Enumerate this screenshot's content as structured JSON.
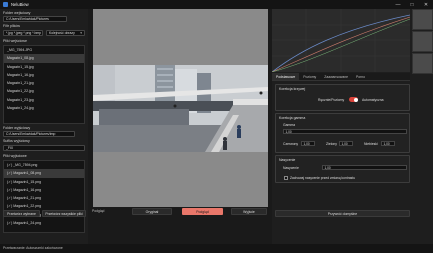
{
  "window": {
    "title": "NeluBiew",
    "controls": [
      "—",
      "□",
      "✕"
    ]
  },
  "left_panel": {
    "input_folder_label": "Folder wejściowy",
    "input_folder_value": "C:/Users/Emkwidak/Pictures",
    "file_filter_label": "Filtr plików",
    "file_filter_value": "*.jpg *.jpeg *.png *.bmp *.tif *.tiff *.webp",
    "sort_value": "Kolejność obrazy",
    "input_files_label": "Pliki wejściowe",
    "input_files": [
      "_MG_7594.JPG",
      "Magazin1_08.jpg",
      "Magazin1_15.jpg",
      "Magazin1_16.jpg",
      "Magazin1_21.jpg",
      "Magazin1_22.jpg",
      "Magazin1_23.jpg",
      "Magazin1_24.jpg"
    ],
    "input_selected_index": 1,
    "output_folder_label": "Folder wyjściowy",
    "output_folder_value": "C:/Users/Emkwidak/Pictures/tmp",
    "suffix_label": "Sufiks wyjściowy",
    "suffix_value": "_FIX",
    "output_files_label": "Pliki wyjściowe",
    "output_files": [
      "(✓) _MG_7594.png",
      "(✓) Magazin1_08.png",
      "(✓) Magazin1_15.png",
      "(✓) Magazin1_16.png",
      "(✓) Magazin1_21.png",
      "(✓) Magazin1_22.png",
      "(✓) Magazin1_23.png",
      "(✓) Magazin1_24.png"
    ],
    "output_selected_index": 1,
    "process_selected_label": "Przetwórz wybrane",
    "process_all_label": "Przetwórz wszystkie pliki"
  },
  "preview": {
    "label": "Podgląd",
    "original_label": "Oryginał",
    "preview_label": "Podgląd",
    "compare_label": "Wyjście"
  },
  "right_panel": {
    "tabs": [
      "Podstawowe",
      "Poziomy",
      "Zaawansowane",
      "Porno"
    ],
    "active_tab_index": 0,
    "curve_group_title": "Korekcja krzywej",
    "curve_mode_manual": "Ręcznie/Poziomy",
    "curve_mode_auto": "Automatyczna",
    "gamma_group_title": "Korekcja gamma",
    "gamma_label": "Gamma",
    "gamma_value": "1,00",
    "red_label": "Czerwony",
    "red_value": "1,00",
    "green_label": "Zielony",
    "green_value": "1,00",
    "blue_label": "Niebieski",
    "blue_value": "1,00",
    "saturation_group_title": "Nasycenie",
    "saturation_label": "Nasycenie",
    "saturation_value": "1,00",
    "preserve_checkbox_label": "Zachowaj nasycenie przed zmianą kontrastu",
    "restore_defaults_label": "Przywróć domyślne"
  },
  "status": {
    "text": "Przetwarzanie: Autoszumki zakończone"
  },
  "colors": {
    "accent": "#d9433a",
    "preview_button": "#e9776a"
  }
}
